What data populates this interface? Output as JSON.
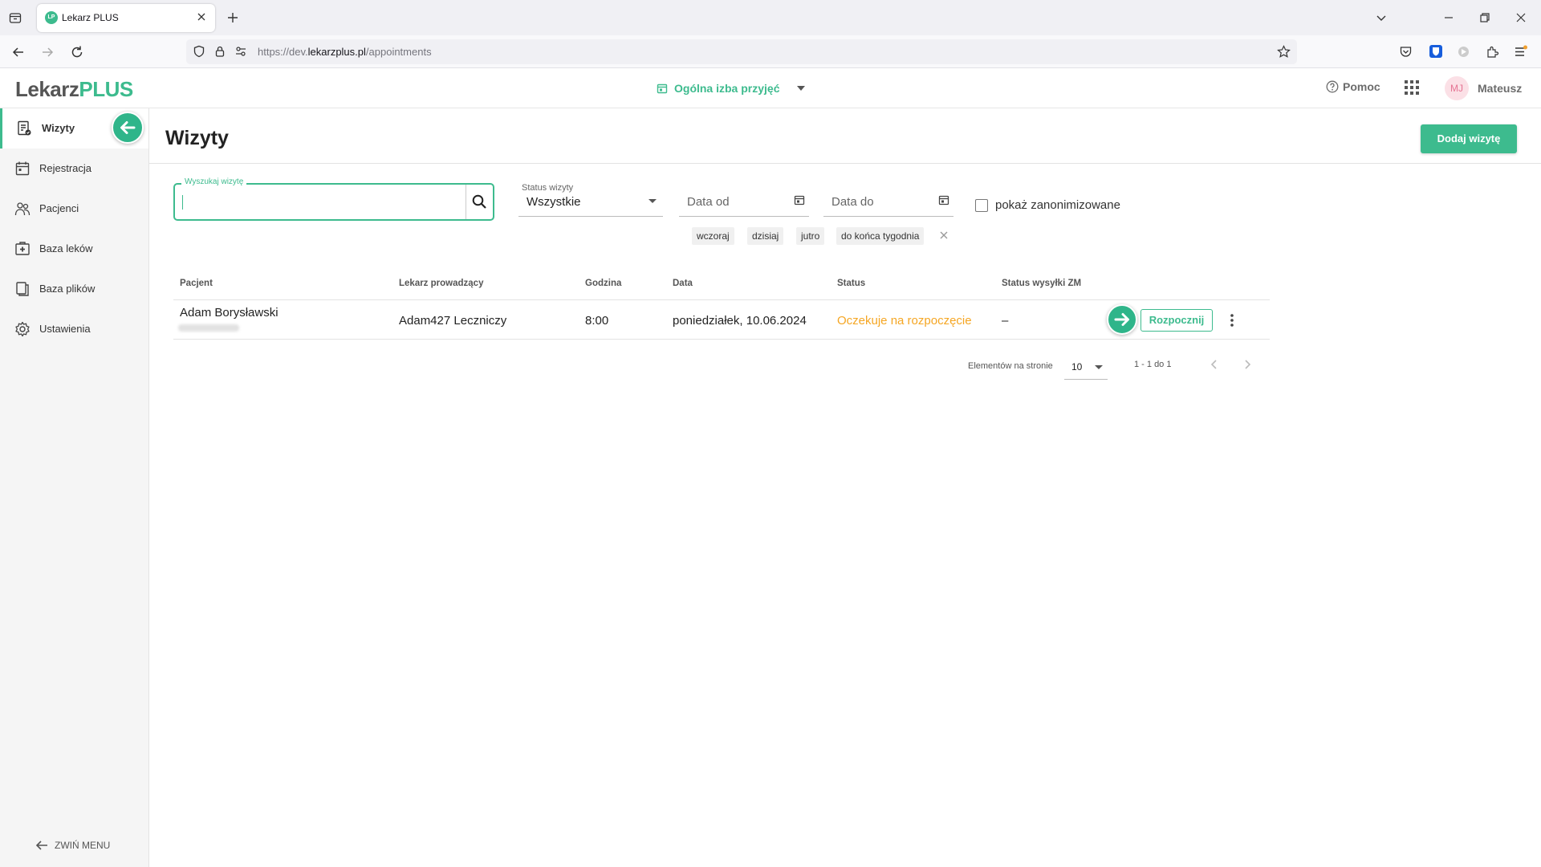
{
  "browser": {
    "tab_title": "Lekarz PLUS",
    "favicon_text": "LP",
    "url_prefix": "https://dev.",
    "url_domain": "lekarzplus.pl",
    "url_path": "/appointments"
  },
  "header": {
    "logo_part1": "Lekarz",
    "logo_part2": "PLUS",
    "ward": "Ogólna izba przyjęć",
    "help": "Pomoc",
    "avatar_initials": "MJ",
    "user_name": "Mateusz"
  },
  "sidebar": {
    "items": [
      {
        "label": "Wizyty",
        "icon": "appointments-icon"
      },
      {
        "label": "Rejestracja",
        "icon": "calendar-icon"
      },
      {
        "label": "Pacjenci",
        "icon": "patients-icon"
      },
      {
        "label": "Baza leków",
        "icon": "medicine-icon"
      },
      {
        "label": "Baza plików",
        "icon": "files-icon"
      },
      {
        "label": "Ustawienia",
        "icon": "gear-icon"
      }
    ],
    "collapse": "ZWIŃ MENU"
  },
  "main": {
    "title": "Wizyty",
    "add_button": "Dodaj wizytę",
    "search_label": "Wyszukaj wizytę",
    "search_value": "",
    "status_label": "Status wizyty",
    "status_value": "Wszystkie",
    "date_from": "Data od",
    "date_to": "Data do",
    "anon_label": "pokaż zanonimizowane",
    "anon_checked": false,
    "chips": [
      "wczoraj",
      "dzisiaj",
      "jutro",
      "do końca tygodnia"
    ]
  },
  "table": {
    "headers": [
      "Pacjent",
      "Lekarz prowadzący",
      "Godzina",
      "Data",
      "Status",
      "Status wysyłki ZM"
    ],
    "rows": [
      {
        "patient": "Adam Borysławski",
        "doctor": "Adam427 Leczniczy",
        "time": "8:00",
        "date": "poniedziałek, 10.06.2024",
        "status": "Oczekuje na rozpoczęcie",
        "zm_status": "–",
        "action": "Rozpocznij"
      }
    ]
  },
  "pagination": {
    "per_page_label": "Elementów na stronie",
    "per_page": "10",
    "range": "1 - 1 do 1"
  },
  "colors": {
    "accent": "#3dbb8e",
    "status_waiting": "#f5a623",
    "annotation_bubble": "#2fb58a"
  }
}
